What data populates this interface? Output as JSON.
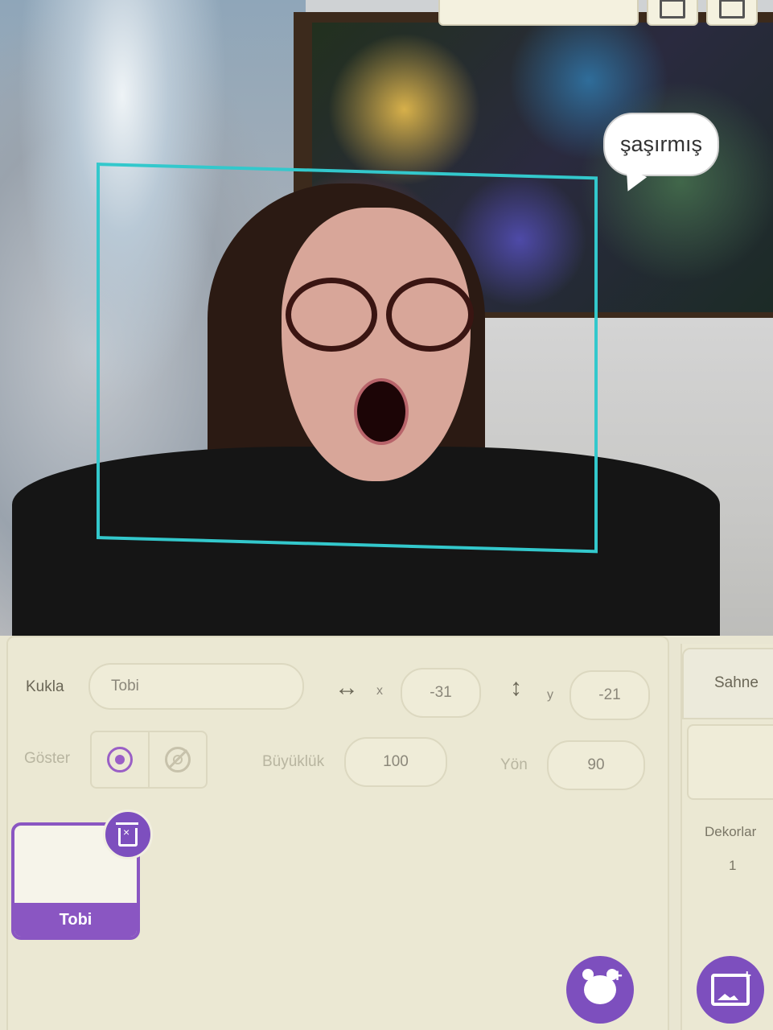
{
  "stage": {
    "speech_bubble": "şaşırmış",
    "detection_box_color": "#33c8cc"
  },
  "sprite_info": {
    "sprite_label": "Kukla",
    "sprite_name": "Tobi",
    "x_label": "x",
    "x_value": "-31",
    "y_label": "y",
    "y_value": "-21",
    "show_label": "Göster",
    "size_label": "Büyüklük",
    "size_value": "100",
    "direction_label": "Yön",
    "direction_value": "90"
  },
  "sprites": [
    {
      "name": "Tobi",
      "selected": true
    }
  ],
  "stage_pane": {
    "title": "Sahne",
    "backdrops_label": "Dekorlar",
    "backdrops_count": "1"
  },
  "icons": {
    "x_arrow": "↔",
    "y_arrow": "↕",
    "show_visible": "eye-icon",
    "show_hidden": "eye-slash-icon",
    "delete": "trash-icon",
    "add_sprite": "bear-plus-icon",
    "add_backdrop": "image-plus-icon"
  },
  "colors": {
    "accent": "#8a56c2",
    "background": "#e9e6d2"
  }
}
